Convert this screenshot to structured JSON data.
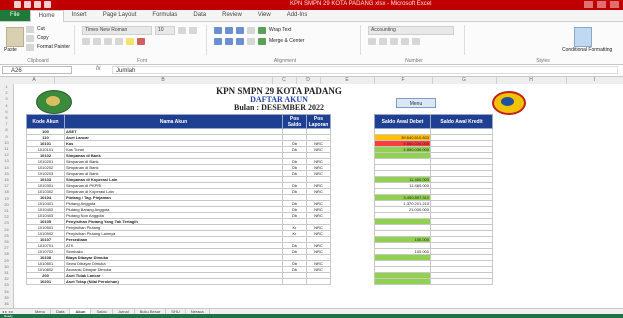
{
  "window": {
    "title": "KPN SMPN 29 KOTA PADANG xlsx - Microsoft Excel"
  },
  "ribbon": {
    "tabs": [
      "File",
      "Home",
      "Insert",
      "Page Layout",
      "Formulas",
      "Data",
      "Review",
      "View",
      "Add-Ins"
    ],
    "active_tab": "Home",
    "clipboard": {
      "paste": "Paste",
      "cut": "Cut",
      "copy": "Copy",
      "format_painter": "Format Painter",
      "label": "Clipboard"
    },
    "font": {
      "name": "Times New Roman",
      "size": "10",
      "label": "Font"
    },
    "alignment": {
      "wrap_text": "Wrap Text",
      "merge": "Merge & Center",
      "label": "Alignment"
    },
    "number": {
      "format": "Accounting",
      "label": "Number"
    },
    "styles": {
      "conditional": "Conditional Formatting",
      "label": "Styles"
    }
  },
  "formula_bar": {
    "name_box": "A26",
    "fx": "fx",
    "value": "Jumlah"
  },
  "columns": [
    "A",
    "B",
    "C",
    "D",
    "E",
    "F",
    "G",
    "H",
    "I"
  ],
  "header": {
    "line1": "KPN SMPN 29 KOTA PADANG",
    "line2": "DAFTAR AKUN",
    "line3": "Bulan : DESEMBER 2022",
    "menu_button": "Menu"
  },
  "coa_table": {
    "headers": [
      "Kode Akun",
      "Nama Akun",
      "Pos Saldo",
      "Pos Laporan"
    ],
    "rows": [
      {
        "code": "100",
        "name": "ASET",
        "dc": "",
        "rep": "",
        "bold": true
      },
      {
        "code": "110",
        "name": "Aset Lancar",
        "dc": "",
        "rep": "",
        "bold": true
      },
      {
        "code": "10101",
        "name": "Kas",
        "dc": "Db",
        "rep": "NRC",
        "bold": true
      },
      {
        "code": "1010101",
        "name": "Kas Tunai",
        "dc": "Db",
        "rep": "NRC",
        "bold": false
      },
      {
        "code": "10102",
        "name": "Simpanan di Bank",
        "dc": "",
        "rep": "",
        "bold": true
      },
      {
        "code": "1010201",
        "name": "Simpanan di Bank",
        "dc": "Db",
        "rep": "NRC",
        "bold": false
      },
      {
        "code": "1010202",
        "name": "Simpanan di Bank",
        "dc": "Db",
        "rep": "NRC",
        "bold": false
      },
      {
        "code": "1010203",
        "name": "Simpanan di Bank",
        "dc": "Db",
        "rep": "NRC",
        "bold": false
      },
      {
        "code": "10103",
        "name": "Simpanan di Koperasi Lain",
        "dc": "",
        "rep": "",
        "bold": true
      },
      {
        "code": "1010301",
        "name": "Simpanan di PKPRI",
        "dc": "Db",
        "rep": "NRC",
        "bold": false
      },
      {
        "code": "1010302",
        "name": "Simpanan di Koperasi Lain",
        "dc": "Db",
        "rep": "NRC",
        "bold": false
      },
      {
        "code": "10104",
        "name": "Piutang / Tag. Pinjaman",
        "dc": "",
        "rep": "",
        "bold": true
      },
      {
        "code": "1010401",
        "name": "Piutang Anggota",
        "dc": "Db",
        "rep": "NRC",
        "bold": false
      },
      {
        "code": "1010402",
        "name": "Piutang Barang Anggota",
        "dc": "Db",
        "rep": "NRC",
        "bold": false
      },
      {
        "code": "1010403",
        "name": "Piutang Non Anggota",
        "dc": "Db",
        "rep": "NRC",
        "bold": false
      },
      {
        "code": "10105",
        "name": "Penyisihan Piutang Yang Tak Tertagih",
        "dc": "",
        "rep": "",
        "bold": true
      },
      {
        "code": "1010501",
        "name": "Penyisihan Piutang",
        "dc": "Kr",
        "rep": "NRC",
        "bold": false
      },
      {
        "code": "1010502",
        "name": "Penyisihan Piutang Lainnya",
        "dc": "Kr",
        "rep": "NRC",
        "bold": false
      },
      {
        "code": "10107",
        "name": "Persediaan",
        "dc": "",
        "rep": "",
        "bold": true
      },
      {
        "code": "1010701",
        "name": "ATK",
        "dc": "Db",
        "rep": "NRC",
        "bold": false
      },
      {
        "code": "1010702",
        "name": "Sembako",
        "dc": "Db",
        "rep": "NRC",
        "bold": false
      },
      {
        "code": "10108",
        "name": "Biaya Dibayar Dimuka",
        "dc": "",
        "rep": "",
        "bold": true
      },
      {
        "code": "1010801",
        "name": "Sewa Dibayar Dimuka",
        "dc": "Db",
        "rep": "NRC",
        "bold": false
      },
      {
        "code": "1010802",
        "name": "Asuransi Dibayar Dimuka",
        "dc": "Db",
        "rep": "NRC",
        "bold": false
      },
      {
        "code": "200",
        "name": "Aset Tidak Lancar",
        "dc": "",
        "rep": "",
        "bold": true
      },
      {
        "code": "10201",
        "name": "Aset Tetap (Nilai Perolehan)",
        "dc": "",
        "rep": "",
        "bold": true
      }
    ]
  },
  "saldo_table": {
    "headers": [
      "Saldo Awal Debet",
      "Saldo Awal Kredit"
    ],
    "rows": [
      {
        "debet": "",
        "kredit": "",
        "hl": ""
      },
      {
        "debet": "39.640.510.833",
        "kredit": "",
        "hl": "orange"
      },
      {
        "debet": "4.850.030.000",
        "kredit": "",
        "hl": "red"
      },
      {
        "debet": "4.850.030.000",
        "kredit": "",
        "hl": "green"
      },
      {
        "debet": "",
        "kredit": "",
        "hl": "green"
      },
      {
        "debet": "",
        "kredit": "",
        "hl": ""
      },
      {
        "debet": "",
        "kredit": "",
        "hl": ""
      },
      {
        "debet": "",
        "kredit": "",
        "hl": ""
      },
      {
        "debet": "11.460.000",
        "kredit": "",
        "hl": "green"
      },
      {
        "debet": "11.460.000",
        "kredit": "",
        "hl": ""
      },
      {
        "debet": "",
        "kredit": "",
        "hl": ""
      },
      {
        "debet": "3.450.897.310",
        "kredit": "",
        "hl": "green"
      },
      {
        "debet": "1.370.201.210",
        "kredit": "",
        "hl": ""
      },
      {
        "debet": "21.000.000",
        "kredit": "",
        "hl": ""
      },
      {
        "debet": "",
        "kredit": "",
        "hl": ""
      },
      {
        "debet": "",
        "kredit": "",
        "hl": "green"
      },
      {
        "debet": "",
        "kredit": "",
        "hl": ""
      },
      {
        "debet": "",
        "kredit": "",
        "hl": ""
      },
      {
        "debet": "100.000",
        "kredit": "",
        "hl": "green"
      },
      {
        "debet": "",
        "kredit": "",
        "hl": ""
      },
      {
        "debet": "100.000",
        "kredit": "",
        "hl": ""
      },
      {
        "debet": "",
        "kredit": "",
        "hl": "green"
      },
      {
        "debet": "",
        "kredit": "",
        "hl": ""
      },
      {
        "debet": "",
        "kredit": "",
        "hl": ""
      },
      {
        "debet": "",
        "kredit": "",
        "hl": "green"
      },
      {
        "debet": "",
        "kredit": "",
        "hl": "green"
      }
    ]
  },
  "sheet_tabs": [
    "Menu",
    "Data",
    "Akun",
    "Saldo",
    "Jurnal",
    "Buku Besar",
    "SHU",
    "Neraca"
  ],
  "active_sheet": "Akun",
  "status": "Ready",
  "colors": {
    "title_bar": "#c00000",
    "header_fill": "#1f3f92",
    "highlight_green": "#92d050",
    "highlight_orange": "#ffc000",
    "highlight_red": "#ff3b3b"
  }
}
